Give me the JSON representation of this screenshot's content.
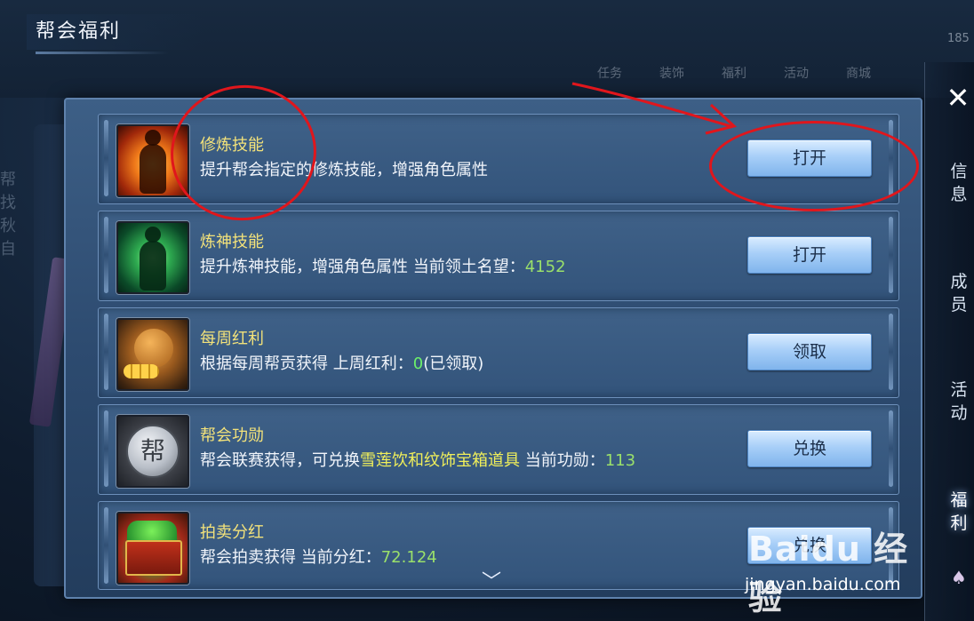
{
  "window": {
    "title": "帮会福利"
  },
  "rows": [
    {
      "name": "修炼技能",
      "desc_parts": [
        "提升帮会指定的修炼技能，增强角色属性"
      ],
      "button": "打开",
      "icon": "meditation-fire-icon"
    },
    {
      "name": "炼神技能",
      "desc_parts": [
        "提升炼神技能，增强角色属性 当前领土名望：",
        "4152"
      ],
      "button": "打开",
      "icon": "meditation-green-icon"
    },
    {
      "name": "每周红利",
      "desc_parts": [
        "根据每周帮贡获得 上周红利：",
        "0",
        "(已领取)"
      ],
      "button": "领取",
      "icon": "money-bag-icon"
    },
    {
      "name": "帮会功勋",
      "desc_parts": [
        "帮会联赛获得，可兑换",
        "雪莲饮和纹饰宝箱道具",
        " 当前功勋：",
        "113"
      ],
      "button": "兑换",
      "icon": "guild-coin-icon"
    },
    {
      "name": "拍卖分红",
      "desc_parts": [
        "帮会拍卖获得 当前分红：",
        "72.124"
      ],
      "button": "兑换",
      "icon": "treasure-chest-icon"
    }
  ],
  "icon_glyphs": {
    "coin": "帮"
  },
  "sidebar": {
    "close_icon": "close-icon",
    "tabs": [
      {
        "label": "信息",
        "chars": [
          "信",
          "息"
        ]
      },
      {
        "label": "成员",
        "chars": [
          "成",
          "员"
        ]
      },
      {
        "label": "活动",
        "chars": [
          "活",
          "动"
        ]
      },
      {
        "label": "福利",
        "chars": [
          "福",
          "利"
        ],
        "active": true
      }
    ]
  },
  "background": {
    "top_nav": [
      "任务",
      "装饰",
      "福利",
      "活动",
      "商城"
    ],
    "top_right_value": "185",
    "left_text": [
      "帮",
      "找",
      "秋",
      "自"
    ]
  },
  "watermark": {
    "logo": "Baidu 经验",
    "url": "jingyan.baidu.com"
  },
  "colors": {
    "highlight_yellow": "#f0ef5a",
    "highlight_green": "#9ae06a",
    "annotation_red": "#e0161c"
  }
}
